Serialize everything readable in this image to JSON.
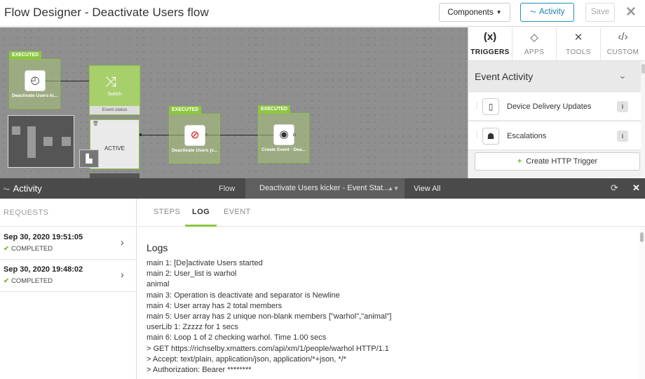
{
  "header": {
    "title": "Flow Designer - Deactivate Users flow",
    "components_label": "Components",
    "activity_label": "Activity",
    "save_label": "Save"
  },
  "canvas": {
    "node1": {
      "badge": "EXECUTED",
      "label": "Deactivate Users ki..."
    },
    "switch": {
      "label": "Switch",
      "footer": "Event.status"
    },
    "active": {
      "label": "ACTIVE"
    },
    "node3": {
      "badge": "EXECUTED",
      "label": "Deactivate Users (v..."
    },
    "node4": {
      "badge": "EXECUTED",
      "label": "Create Event - Dea..."
    }
  },
  "right_panel": {
    "tabs": [
      {
        "label": "TRIGGERS",
        "icon": "(x)"
      },
      {
        "label": "APPS",
        "icon": "◇"
      },
      {
        "label": "TOOLS",
        "icon": "✕"
      },
      {
        "label": "CUSTOM",
        "icon": "‹/›"
      }
    ],
    "section_title": "Event Activity",
    "items": [
      {
        "label": "Device Delivery Updates",
        "icon": "device-icon"
      },
      {
        "label": "Escalations",
        "icon": "escalation-icon"
      }
    ],
    "http_trigger_label": "Create HTTP Trigger"
  },
  "activity_bar": {
    "title": "Activity",
    "flow_label": "Flow",
    "selected_flow": "Deactivate Users kicker - Event Stat...",
    "view_all": "View All"
  },
  "requests": {
    "header": "REQUESTS",
    "items": [
      {
        "date": "Sep 30, 2020 19:51:05",
        "status": "COMPLETED"
      },
      {
        "date": "Sep 30, 2020 19:48:02",
        "status": "COMPLETED"
      }
    ]
  },
  "log_panel": {
    "tabs": [
      "STEPS",
      "LOG",
      "EVENT"
    ],
    "title": "Logs",
    "lines": [
      "main 1: [De]activate Users started",
      "main 2: User_list is warhol",
      "animal",
      "main 3: Operation is deactivate and separator is Newline",
      "main 4: User array has 2 total members",
      "main 5: User array has 2 unique non-blank members [\"warhol\",\"animal\"]",
      "userLib 1: Zzzzz for 1 secs",
      "main 6: Loop 1 of 2 checking warhol. Time 1.00 secs",
      "> GET https://richselby.xmatters.com/api/xm/1/people/warhol HTTP/1.1",
      "> Accept: text/plain, application/json, application/*+json, */*",
      "> Authorization: Bearer ********"
    ]
  },
  "colors": {
    "executed_green": "#8cc63f",
    "activity_blue": "#1f8fbf",
    "dark_bar": "#4a4a4a"
  }
}
